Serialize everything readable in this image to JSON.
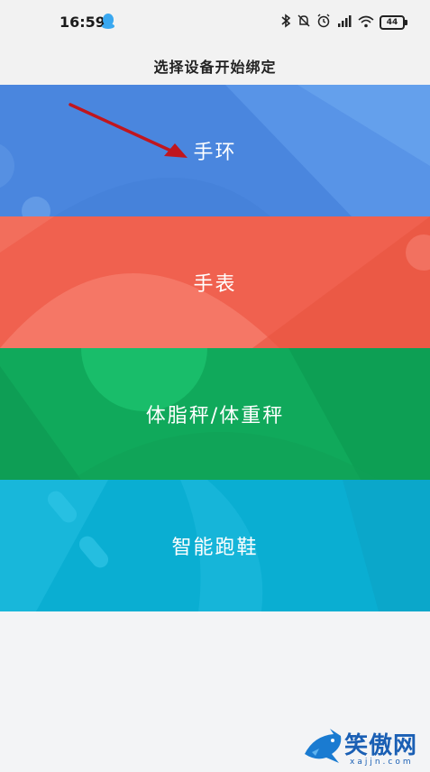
{
  "status_bar": {
    "time": "16:59",
    "icons": [
      "qq-icon",
      "bluetooth-icon",
      "mute-icon",
      "alarm-icon",
      "signal-icon",
      "wifi-icon",
      "battery-icon"
    ],
    "battery": "44"
  },
  "header": {
    "title": "选择设备开始绑定"
  },
  "devices": [
    {
      "label": "手环",
      "color": "#4a86de"
    },
    {
      "label": "手表",
      "color": "#f0614f"
    },
    {
      "label": "体脂秤/体重秤",
      "color": "#10a95b"
    },
    {
      "label": "智能跑鞋",
      "color": "#0aaed2"
    }
  ],
  "annotation": {
    "arrow_color": "#c0161e"
  },
  "watermark": {
    "text": "笑傲网",
    "url": "xajjn.com"
  }
}
